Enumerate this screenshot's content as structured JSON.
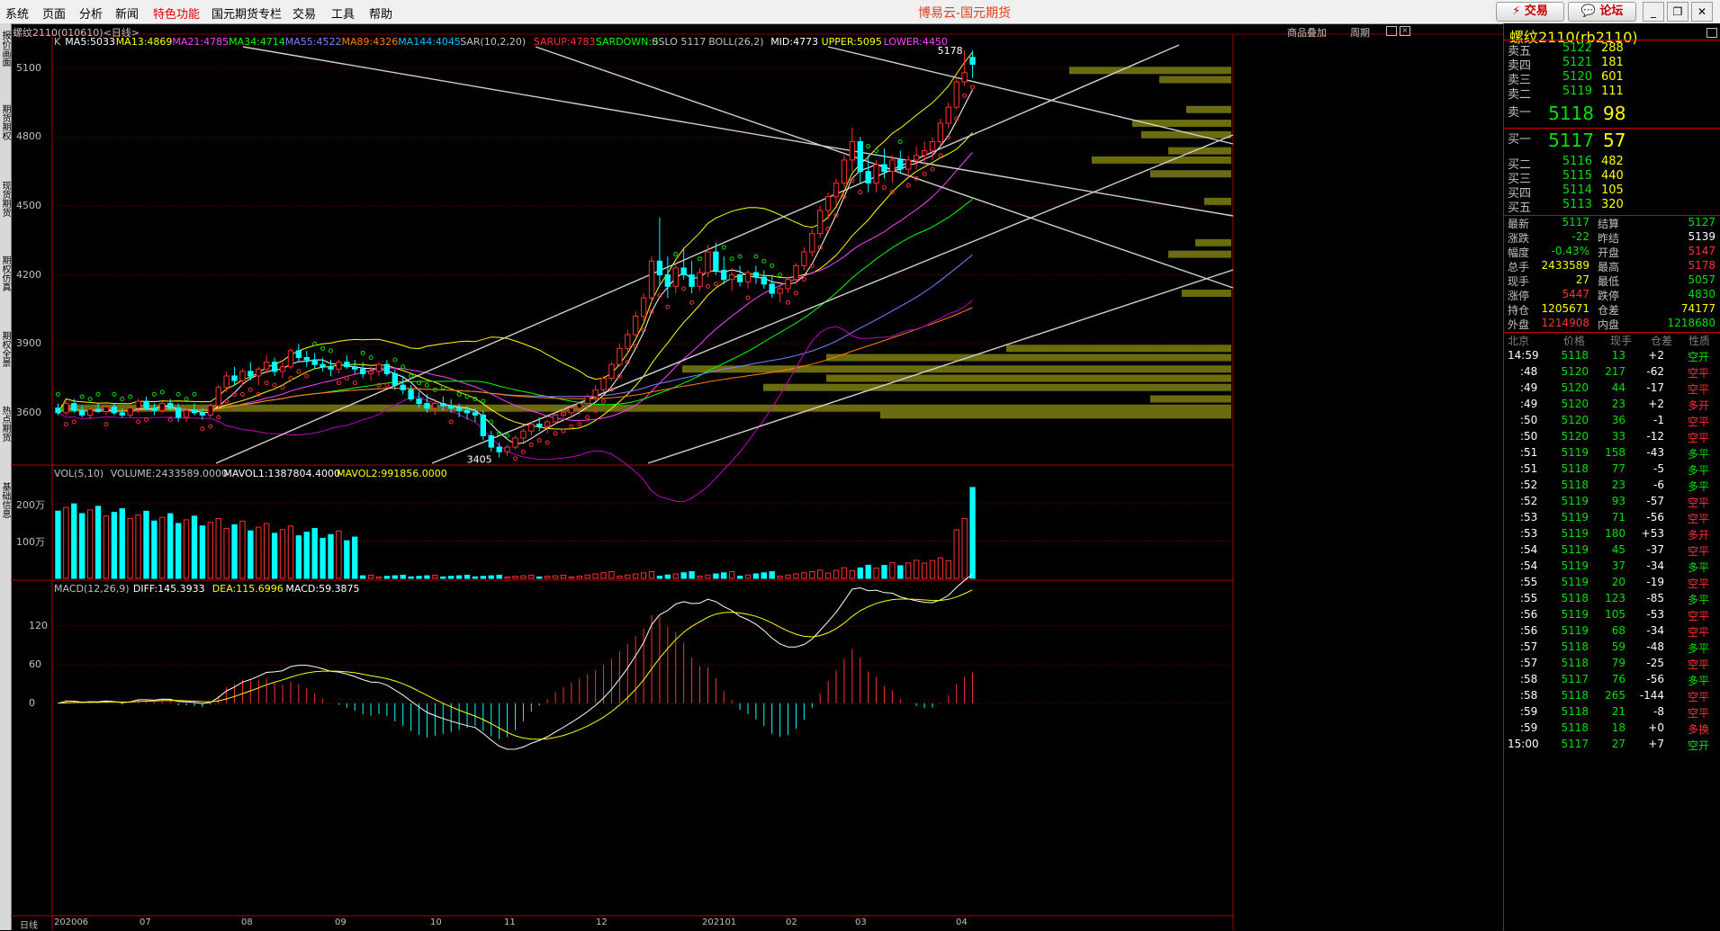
{
  "menu": [
    "系统",
    "页面",
    "分析",
    "新闻",
    "特色功能",
    "国元期货专栏",
    "交易",
    "工具",
    "帮助"
  ],
  "menu_highlight": "特色功能",
  "app_title": "博易云-国元期货",
  "buttons": {
    "trade": "交易",
    "forum": "论坛"
  },
  "left_tabs": [
    "报价画面",
    "期货期权",
    "现货期货",
    "期权仿真",
    "期权全景",
    "热点期货",
    "基础信息"
  ],
  "chart": {
    "instrument_label": "螺纹2110(010610)<日线>",
    "top_links": [
      "商品叠加",
      "周期"
    ],
    "indicator_line": [
      {
        "t": "K",
        "c": "#c0c0c0"
      },
      {
        "t": "MA5:5033",
        "c": "#ffffff"
      },
      {
        "t": "MA13:4869",
        "c": "#ffff00"
      },
      {
        "t": "MA21:4785",
        "c": "#ff40ff"
      },
      {
        "t": "MA34:4714",
        "c": "#00ff00"
      },
      {
        "t": "MA55:4522",
        "c": "#8080ff"
      },
      {
        "t": "MA89:4326",
        "c": "#ff8000"
      },
      {
        "t": "MA144:4045",
        "c": "#00c0ff"
      },
      {
        "t": "SAR(10,2,20)",
        "c": "#c0c0c0"
      },
      {
        "t": "SARUP:4783",
        "c": "#ff3030"
      },
      {
        "t": "SARDOWN:0",
        "c": "#00ff00"
      },
      {
        "t": "SSLO 5117",
        "c": "#c0c0c0"
      },
      {
        "t": "BOLL(26,2)",
        "c": "#c0c0c0"
      },
      {
        "t": "MID:4773",
        "c": "#ffffff"
      },
      {
        "t": "UPPER:5095",
        "c": "#ffff00"
      },
      {
        "t": "LOWER:4450",
        "c": "#ff40ff"
      }
    ],
    "y_ticks": [
      "5100",
      "4800",
      "4500",
      "4200",
      "3900",
      "3600"
    ],
    "high_label": "5178",
    "low_label": "3405",
    "vol_line": [
      {
        "t": "VOL(5,10)",
        "c": "#c0c0c0"
      },
      {
        "t": "VOLUME:2433589.0000",
        "c": "#c0c0c0"
      },
      {
        "t": "MAVOL1:1387804.4000",
        "c": "#ffffff"
      },
      {
        "t": "MAVOL2:991856.0000",
        "c": "#ffff00"
      }
    ],
    "vol_ticks": [
      "200万",
      "100万"
    ],
    "macd_line": [
      {
        "t": "MACD(12,26,9)",
        "c": "#c0c0c0"
      },
      {
        "t": "DIFF:145.3933",
        "c": "#ffffff"
      },
      {
        "t": "DEA:115.6996",
        "c": "#ffff00"
      },
      {
        "t": "MACD:59.3875",
        "c": "#ffffff"
      }
    ],
    "macd_ticks": [
      "120",
      "60",
      "0"
    ],
    "x_period_label": "日线",
    "x_ticks": [
      "202006",
      "07",
      "08",
      "09",
      "10",
      "11",
      "12",
      "202101",
      "02",
      "03",
      "04"
    ]
  },
  "quote": {
    "title": "螺纹2110(rb2110)",
    "asks": [
      {
        "label": "卖五",
        "price": "5122",
        "vol": "288"
      },
      {
        "label": "卖四",
        "price": "5121",
        "vol": "181"
      },
      {
        "label": "卖三",
        "price": "5120",
        "vol": "601"
      },
      {
        "label": "卖二",
        "price": "5119",
        "vol": "111"
      },
      {
        "label": "卖一",
        "price": "5118",
        "vol": "98"
      }
    ],
    "bids": [
      {
        "label": "买一",
        "price": "5117",
        "vol": "57"
      },
      {
        "label": "买二",
        "price": "5116",
        "vol": "482"
      },
      {
        "label": "买三",
        "price": "5115",
        "vol": "440"
      },
      {
        "label": "买四",
        "price": "5114",
        "vol": "105"
      },
      {
        "label": "买五",
        "price": "5113",
        "vol": "320"
      }
    ],
    "stats": [
      {
        "l1": "最新",
        "v1": "5117",
        "c1": "#00e000",
        "l2": "结算",
        "v2": "5127",
        "c2": "#00e000"
      },
      {
        "l1": "涨跌",
        "v1": "-22",
        "c1": "#00e000",
        "l2": "昨结",
        "v2": "5139",
        "c2": "#ffffff"
      },
      {
        "l1": "幅度",
        "v1": "-0.43%",
        "c1": "#00e000",
        "l2": "开盘",
        "v2": "5147",
        "c2": "#ff3030"
      },
      {
        "l1": "总手",
        "v1": "2433589",
        "c1": "#ffff00",
        "l2": "最高",
        "v2": "5178",
        "c2": "#ff3030"
      },
      {
        "l1": "现手",
        "v1": "27",
        "c1": "#ffff00",
        "l2": "最低",
        "v2": "5057",
        "c2": "#00e000"
      },
      {
        "l1": "涨停",
        "v1": "5447",
        "c1": "#ff3030",
        "l2": "跌停",
        "v2": "4830",
        "c2": "#00e000"
      },
      {
        "l1": "持仓",
        "v1": "1205671",
        "c1": "#ffff00",
        "l2": "仓差",
        "v2": "74177",
        "c2": "#ffff00"
      },
      {
        "l1": "外盘",
        "v1": "1214908",
        "c1": "#ff3030",
        "l2": "内盘",
        "v2": "1218680",
        "c2": "#00e000"
      }
    ],
    "tick_header": [
      "北京",
      "价格",
      "现手",
      "仓差",
      "性质"
    ],
    "ticks": [
      {
        "t": "14:59",
        "p": "5118",
        "v": "13",
        "d": "+2",
        "n": "空开",
        "nc": "#00e000"
      },
      {
        "t": ":48",
        "p": "5120",
        "v": "217",
        "d": "-62",
        "n": "空平",
        "nc": "#ff3030"
      },
      {
        "t": ":49",
        "p": "5120",
        "v": "44",
        "d": "-17",
        "n": "空平",
        "nc": "#ff3030"
      },
      {
        "t": ":49",
        "p": "5120",
        "v": "23",
        "d": "+2",
        "n": "多开",
        "nc": "#ff3030"
      },
      {
        "t": ":50",
        "p": "5120",
        "v": "36",
        "d": "-1",
        "n": "空平",
        "nc": "#ff3030"
      },
      {
        "t": ":50",
        "p": "5120",
        "v": "33",
        "d": "-12",
        "n": "空平",
        "nc": "#ff3030"
      },
      {
        "t": ":51",
        "p": "5119",
        "v": "158",
        "d": "-43",
        "n": "多平",
        "nc": "#00e000"
      },
      {
        "t": ":51",
        "p": "5118",
        "v": "77",
        "d": "-5",
        "n": "多平",
        "nc": "#00e000"
      },
      {
        "t": ":52",
        "p": "5118",
        "v": "23",
        "d": "-6",
        "n": "多平",
        "nc": "#00e000"
      },
      {
        "t": ":52",
        "p": "5119",
        "v": "93",
        "d": "-57",
        "n": "空平",
        "nc": "#ff3030"
      },
      {
        "t": ":53",
        "p": "5119",
        "v": "71",
        "d": "-56",
        "n": "空平",
        "nc": "#ff3030"
      },
      {
        "t": ":53",
        "p": "5119",
        "v": "180",
        "d": "+53",
        "n": "多开",
        "nc": "#ff3030"
      },
      {
        "t": ":54",
        "p": "5119",
        "v": "45",
        "d": "-37",
        "n": "空平",
        "nc": "#ff3030"
      },
      {
        "t": ":54",
        "p": "5119",
        "v": "37",
        "d": "-34",
        "n": "多平",
        "nc": "#00e000"
      },
      {
        "t": ":55",
        "p": "5119",
        "v": "20",
        "d": "-19",
        "n": "空平",
        "nc": "#ff3030"
      },
      {
        "t": ":55",
        "p": "5118",
        "v": "123",
        "d": "-85",
        "n": "多平",
        "nc": "#00e000"
      },
      {
        "t": ":56",
        "p": "5119",
        "v": "105",
        "d": "-53",
        "n": "空平",
        "nc": "#ff3030"
      },
      {
        "t": ":56",
        "p": "5119",
        "v": "68",
        "d": "-34",
        "n": "空平",
        "nc": "#ff3030"
      },
      {
        "t": ":57",
        "p": "5118",
        "v": "59",
        "d": "-48",
        "n": "多平",
        "nc": "#00e000"
      },
      {
        "t": ":57",
        "p": "5118",
        "v": "79",
        "d": "-25",
        "n": "空平",
        "nc": "#ff3030"
      },
      {
        "t": ":58",
        "p": "5117",
        "v": "76",
        "d": "-56",
        "n": "多平",
        "nc": "#00e000"
      },
      {
        "t": ":58",
        "p": "5118",
        "v": "265",
        "d": "-144",
        "n": "空平",
        "nc": "#ff3030"
      },
      {
        "t": ":59",
        "p": "5118",
        "v": "21",
        "d": "-8",
        "n": "空平",
        "nc": "#ff3030"
      },
      {
        "t": ":59",
        "p": "5118",
        "v": "18",
        "d": "+0",
        "n": "多换",
        "nc": "#ff3030"
      },
      {
        "t": "15:00",
        "p": "5117",
        "v": "27",
        "d": "+7",
        "n": "空开",
        "nc": "#00e000"
      }
    ]
  },
  "chart_data": {
    "type": "candlestick",
    "instrument": "螺纹2110",
    "period": "日线",
    "ylim": [
      3380,
      5240
    ],
    "bars": [
      [
        3620,
        3640,
        3590,
        3600
      ],
      [
        3600,
        3650,
        3590,
        3640
      ],
      [
        3640,
        3660,
        3600,
        3610
      ],
      [
        3610,
        3630,
        3580,
        3590
      ],
      [
        3590,
        3620,
        3570,
        3615
      ],
      [
        3615,
        3640,
        3600,
        3605
      ],
      [
        3605,
        3630,
        3590,
        3625
      ],
      [
        3625,
        3640,
        3590,
        3600
      ],
      [
        3600,
        3620,
        3580,
        3590
      ],
      [
        3590,
        3630,
        3580,
        3620
      ],
      [
        3620,
        3660,
        3600,
        3650
      ],
      [
        3650,
        3670,
        3610,
        3620
      ],
      [
        3620,
        3640,
        3590,
        3610
      ],
      [
        3610,
        3650,
        3600,
        3640
      ],
      [
        3640,
        3660,
        3610,
        3620
      ],
      [
        3620,
        3640,
        3560,
        3580
      ],
      [
        3580,
        3620,
        3560,
        3610
      ],
      [
        3610,
        3640,
        3590,
        3600
      ],
      [
        3600,
        3620,
        3570,
        3590
      ],
      [
        3590,
        3640,
        3580,
        3630
      ],
      [
        3630,
        3720,
        3620,
        3710
      ],
      [
        3710,
        3780,
        3690,
        3760
      ],
      [
        3760,
        3800,
        3720,
        3740
      ],
      [
        3740,
        3790,
        3720,
        3780
      ],
      [
        3780,
        3820,
        3740,
        3760
      ],
      [
        3760,
        3800,
        3720,
        3790
      ],
      [
        3790,
        3850,
        3770,
        3820
      ],
      [
        3820,
        3840,
        3760,
        3780
      ],
      [
        3780,
        3820,
        3750,
        3800
      ],
      [
        3800,
        3880,
        3790,
        3870
      ],
      [
        3870,
        3900,
        3820,
        3840
      ],
      [
        3840,
        3870,
        3800,
        3830
      ],
      [
        3830,
        3860,
        3790,
        3810
      ],
      [
        3810,
        3840,
        3780,
        3800
      ],
      [
        3800,
        3830,
        3760,
        3790
      ],
      [
        3790,
        3830,
        3770,
        3820
      ],
      [
        3820,
        3850,
        3790,
        3800
      ],
      [
        3800,
        3830,
        3770,
        3790
      ],
      [
        3790,
        3820,
        3750,
        3770
      ],
      [
        3770,
        3800,
        3740,
        3780
      ],
      [
        3780,
        3820,
        3760,
        3810
      ],
      [
        3810,
        3830,
        3760,
        3770
      ],
      [
        3770,
        3790,
        3700,
        3720
      ],
      [
        3720,
        3760,
        3680,
        3700
      ],
      [
        3700,
        3720,
        3650,
        3660
      ],
      [
        3660,
        3690,
        3620,
        3640
      ],
      [
        3640,
        3680,
        3600,
        3620
      ],
      [
        3620,
        3660,
        3590,
        3640
      ],
      [
        3640,
        3670,
        3610,
        3630
      ],
      [
        3630,
        3660,
        3600,
        3620
      ],
      [
        3620,
        3640,
        3580,
        3610
      ],
      [
        3610,
        3630,
        3570,
        3600
      ],
      [
        3600,
        3620,
        3560,
        3590
      ],
      [
        3590,
        3610,
        3480,
        3500
      ],
      [
        3500,
        3520,
        3430,
        3450
      ],
      [
        3450,
        3470,
        3405,
        3430
      ],
      [
        3430,
        3460,
        3410,
        3450
      ],
      [
        3450,
        3500,
        3440,
        3490
      ],
      [
        3490,
        3530,
        3470,
        3520
      ],
      [
        3520,
        3560,
        3500,
        3550
      ],
      [
        3550,
        3580,
        3520,
        3540
      ],
      [
        3540,
        3570,
        3510,
        3560
      ],
      [
        3560,
        3600,
        3550,
        3590
      ],
      [
        3590,
        3620,
        3560,
        3600
      ],
      [
        3600,
        3630,
        3580,
        3620
      ],
      [
        3620,
        3650,
        3590,
        3640
      ],
      [
        3640,
        3680,
        3620,
        3670
      ],
      [
        3670,
        3720,
        3650,
        3700
      ],
      [
        3700,
        3760,
        3690,
        3750
      ],
      [
        3750,
        3820,
        3740,
        3810
      ],
      [
        3810,
        3900,
        3800,
        3880
      ],
      [
        3880,
        3960,
        3860,
        3940
      ],
      [
        3940,
        4040,
        3930,
        4020
      ],
      [
        4020,
        4120,
        4000,
        4100
      ],
      [
        4100,
        4280,
        4080,
        4260
      ],
      [
        4260,
        4450,
        4150,
        4200
      ],
      [
        4200,
        4280,
        4100,
        4150
      ],
      [
        4150,
        4250,
        4120,
        4230
      ],
      [
        4230,
        4320,
        4180,
        4200
      ],
      [
        4200,
        4260,
        4120,
        4150
      ],
      [
        4150,
        4230,
        4130,
        4210
      ],
      [
        4210,
        4330,
        4190,
        4300
      ],
      [
        4300,
        4340,
        4200,
        4220
      ],
      [
        4220,
        4280,
        4160,
        4180
      ],
      [
        4180,
        4230,
        4130,
        4200
      ],
      [
        4200,
        4240,
        4150,
        4170
      ],
      [
        4170,
        4220,
        4140,
        4210
      ],
      [
        4210,
        4240,
        4160,
        4190
      ],
      [
        4190,
        4220,
        4140,
        4160
      ],
      [
        4160,
        4200,
        4100,
        4120
      ],
      [
        4120,
        4160,
        4080,
        4140
      ],
      [
        4140,
        4190,
        4120,
        4180
      ],
      [
        4180,
        4250,
        4160,
        4240
      ],
      [
        4240,
        4320,
        4220,
        4300
      ],
      [
        4300,
        4400,
        4280,
        4380
      ],
      [
        4380,
        4500,
        4360,
        4480
      ],
      [
        4480,
        4560,
        4440,
        4540
      ],
      [
        4540,
        4620,
        4500,
        4600
      ],
      [
        4600,
        4720,
        4580,
        4700
      ],
      [
        4700,
        4840,
        4650,
        4780
      ],
      [
        4780,
        4800,
        4600,
        4650
      ],
      [
        4650,
        4720,
        4560,
        4600
      ],
      [
        4600,
        4700,
        4560,
        4680
      ],
      [
        4680,
        4750,
        4620,
        4650
      ],
      [
        4650,
        4720,
        4600,
        4700
      ],
      [
        4700,
        4740,
        4640,
        4660
      ],
      [
        4660,
        4720,
        4630,
        4700
      ],
      [
        4700,
        4760,
        4660,
        4720
      ],
      [
        4720,
        4780,
        4680,
        4740
      ],
      [
        4740,
        4800,
        4700,
        4780
      ],
      [
        4780,
        4880,
        4760,
        4860
      ],
      [
        4860,
        4950,
        4840,
        4930
      ],
      [
        4930,
        5060,
        4920,
        5040
      ],
      [
        5040,
        5178,
        5020,
        5080
      ],
      [
        5147,
        5178,
        5057,
        5117
      ]
    ],
    "volume_units": "万手",
    "macd": {
      "diff": 145.3933,
      "dea": 115.6996,
      "macd": 59.3875
    }
  }
}
